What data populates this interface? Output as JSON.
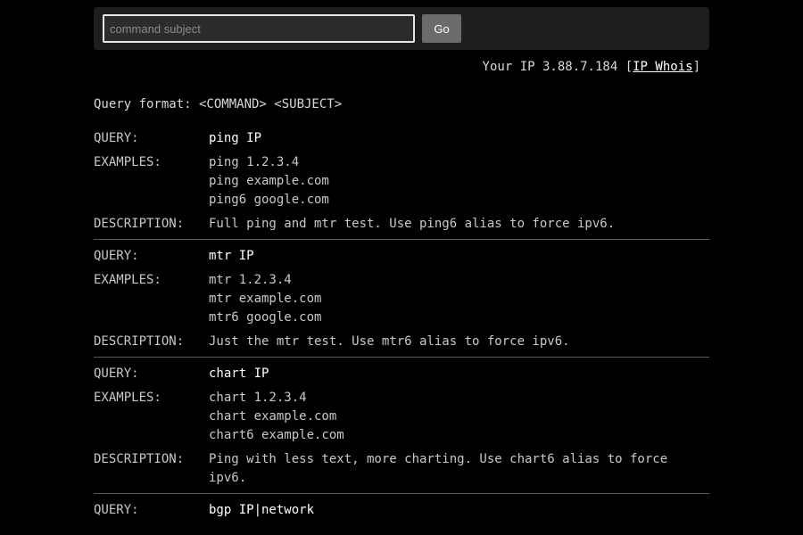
{
  "search": {
    "placeholder": "command subject",
    "go_label": "Go"
  },
  "ip_info": {
    "prefix": "Your IP 3.88.7.184 [",
    "link_label": "IP Whois",
    "suffix": "]"
  },
  "query_format": "Query format: <COMMAND> <SUBJECT>",
  "labels": {
    "query": "QUERY:",
    "examples": "EXAMPLES:",
    "description": "DESCRIPTION:"
  },
  "commands": [
    {
      "query": "ping IP",
      "examples": [
        "ping 1.2.3.4",
        "ping example.com",
        "ping6 google.com"
      ],
      "description": "Full ping and mtr test. Use ping6 alias to force ipv6."
    },
    {
      "query": "mtr IP",
      "examples": [
        "mtr 1.2.3.4",
        "mtr example.com",
        "mtr6 google.com"
      ],
      "description": "Just the mtr test. Use mtr6 alias to force ipv6."
    },
    {
      "query": "chart IP",
      "examples": [
        "chart 1.2.3.4",
        "chart example.com",
        "chart6 example.com"
      ],
      "description": "Ping with less text, more charting. Use chart6 alias to force ipv6."
    },
    {
      "query": "bgp IP|network",
      "examples": [],
      "description": ""
    }
  ]
}
